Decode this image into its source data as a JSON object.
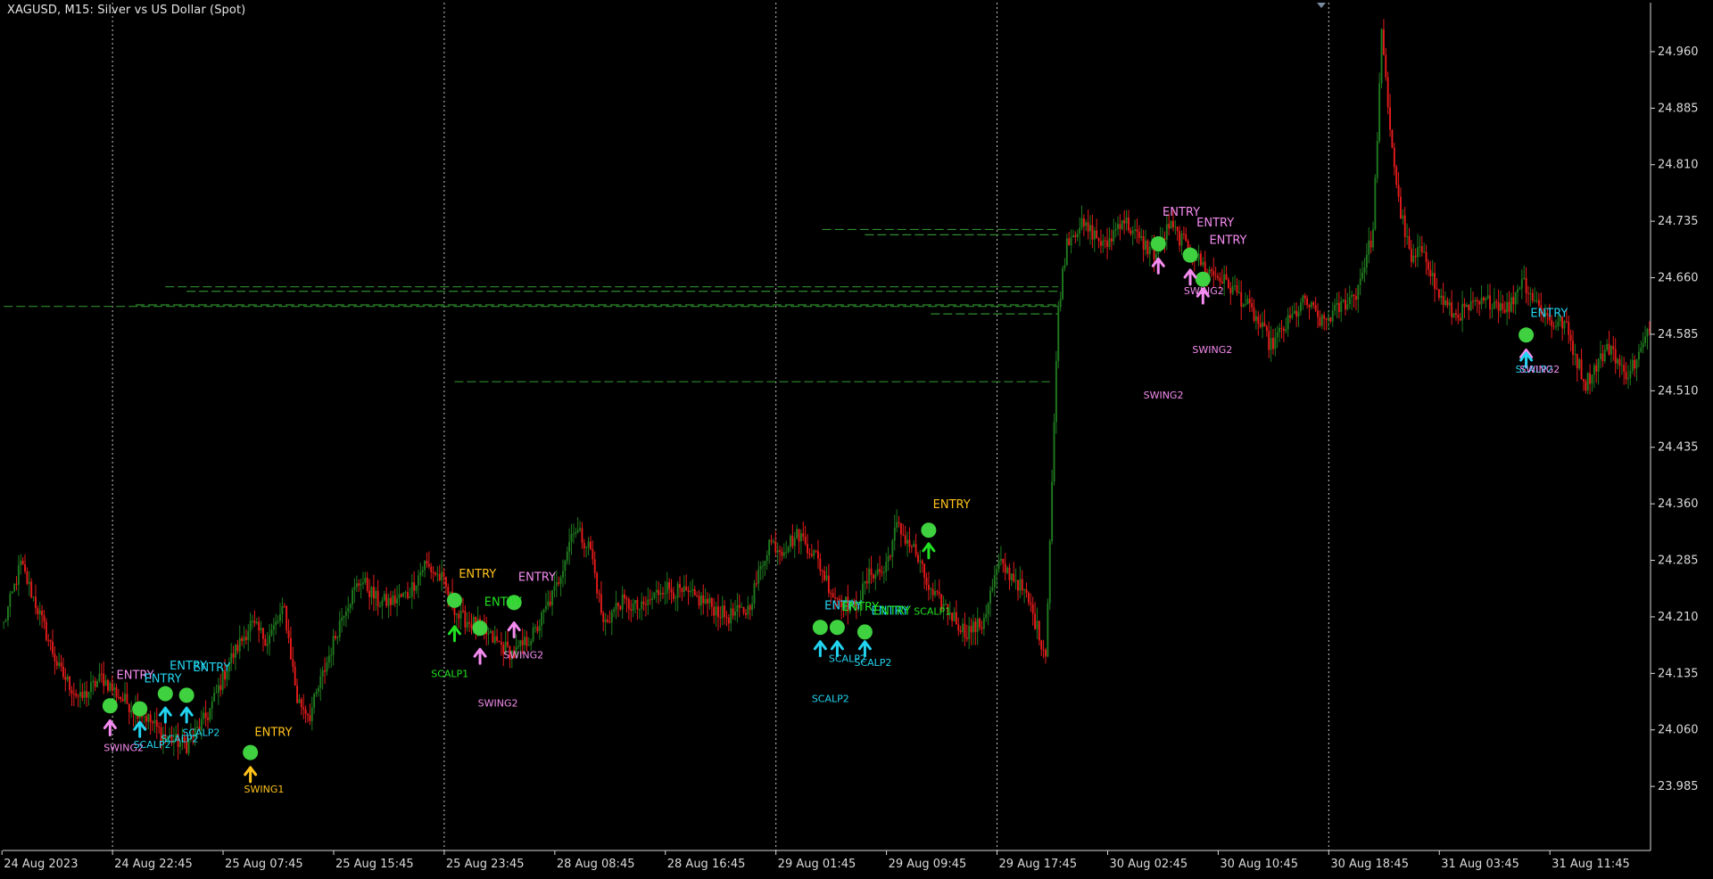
{
  "window": {
    "symbol_title": "XAGUSD, M15:  Silver vs US Dollar (Spot)"
  },
  "colors": {
    "background": "#000000",
    "axis": "#d9d9d9",
    "grid": "#c8c8c8",
    "bull": "#1f7a1f",
    "bear": "#e61b1b",
    "level_line": "#2e8b2e",
    "dot": "#3fd13f",
    "swing1": "#ffc21a",
    "swing2": "#f58cf0",
    "scalp1": "#22e022",
    "scalp2": "#22d4f0"
  },
  "chart_data": {
    "type": "candlestick",
    "title": "XAGUSD, M15:  Silver vs US Dollar (Spot)",
    "ylim": [
      23.9,
      25.025
    ],
    "y_ticks": [
      "24.960",
      "24.885",
      "24.810",
      "24.735",
      "24.660",
      "24.585",
      "24.510",
      "24.435",
      "24.360",
      "24.285",
      "24.210",
      "24.135",
      "24.060",
      "23.985"
    ],
    "x_ticks": [
      "24 Aug 2023",
      "24 Aug 22:45",
      "25 Aug 07:45",
      "25 Aug 15:45",
      "25 Aug 23:45",
      "28 Aug 08:45",
      "28 Aug 16:45",
      "29 Aug 01:45",
      "29 Aug 09:45",
      "29 Aug 17:45",
      "30 Aug 02:45",
      "30 Aug 10:45",
      "30 Aug 18:45",
      "31 Aug 03:45",
      "31 Aug 11:45"
    ],
    "session_separators": [
      "24 Aug 22:45",
      "25 Aug 23:45",
      "29 Aug 01:45",
      "29 Aug 17:45",
      "30 Aug 18:45"
    ],
    "price_path": [
      [
        0,
        24.2
      ],
      [
        8,
        24.28
      ],
      [
        16,
        24.22
      ],
      [
        26,
        24.14
      ],
      [
        36,
        24.1
      ],
      [
        46,
        24.13
      ],
      [
        56,
        24.1
      ],
      [
        66,
        24.08
      ],
      [
        76,
        24.05
      ],
      [
        86,
        24.04
      ],
      [
        96,
        24.08
      ],
      [
        106,
        24.15
      ],
      [
        116,
        24.2
      ],
      [
        124,
        24.18
      ],
      [
        132,
        24.22
      ],
      [
        138,
        24.1
      ],
      [
        144,
        24.08
      ],
      [
        152,
        24.15
      ],
      [
        160,
        24.22
      ],
      [
        168,
        24.26
      ],
      [
        176,
        24.23
      ],
      [
        182,
        24.23
      ],
      [
        190,
        24.24
      ],
      [
        198,
        24.28
      ],
      [
        206,
        24.26
      ],
      [
        214,
        24.21
      ],
      [
        222,
        24.2
      ],
      [
        230,
        24.18
      ],
      [
        240,
        24.16
      ],
      [
        250,
        24.19
      ],
      [
        260,
        24.25
      ],
      [
        268,
        24.33
      ],
      [
        276,
        24.3
      ],
      [
        282,
        24.2
      ],
      [
        290,
        24.23
      ],
      [
        300,
        24.22
      ],
      [
        310,
        24.25
      ],
      [
        320,
        24.24
      ],
      [
        330,
        24.23
      ],
      [
        340,
        24.21
      ],
      [
        350,
        24.22
      ],
      [
        360,
        24.31
      ],
      [
        366,
        24.3
      ],
      [
        374,
        24.32
      ],
      [
        382,
        24.29
      ],
      [
        390,
        24.24
      ],
      [
        400,
        24.22
      ],
      [
        408,
        24.27
      ],
      [
        414,
        24.27
      ],
      [
        420,
        24.33
      ],
      [
        428,
        24.3
      ],
      [
        436,
        24.24
      ],
      [
        444,
        24.22
      ],
      [
        452,
        24.19
      ],
      [
        460,
        24.2
      ],
      [
        468,
        24.28
      ],
      [
        476,
        24.26
      ],
      [
        482,
        24.23
      ],
      [
        490,
        24.16
      ],
      [
        496,
        24.62
      ],
      [
        500,
        24.71
      ],
      [
        506,
        24.73
      ],
      [
        512,
        24.72
      ],
      [
        518,
        24.7
      ],
      [
        526,
        24.74
      ],
      [
        534,
        24.71
      ],
      [
        542,
        24.69
      ],
      [
        548,
        24.73
      ],
      [
        554,
        24.71
      ],
      [
        560,
        24.69
      ],
      [
        566,
        24.67
      ],
      [
        572,
        24.66
      ],
      [
        580,
        24.64
      ],
      [
        588,
        24.61
      ],
      [
        596,
        24.57
      ],
      [
        604,
        24.6
      ],
      [
        612,
        24.63
      ],
      [
        620,
        24.6
      ],
      [
        628,
        24.62
      ],
      [
        636,
        24.64
      ],
      [
        644,
        24.72
      ],
      [
        648,
        24.98
      ],
      [
        652,
        24.86
      ],
      [
        656,
        24.76
      ],
      [
        662,
        24.68
      ],
      [
        668,
        24.7
      ],
      [
        674,
        24.64
      ],
      [
        682,
        24.61
      ],
      [
        690,
        24.62
      ],
      [
        700,
        24.63
      ],
      [
        708,
        24.62
      ],
      [
        714,
        24.66
      ],
      [
        720,
        24.63
      ],
      [
        728,
        24.6
      ],
      [
        734,
        24.6
      ],
      [
        740,
        24.55
      ],
      [
        744,
        24.52
      ],
      [
        750,
        24.55
      ],
      [
        756,
        24.57
      ],
      [
        762,
        24.53
      ],
      [
        768,
        24.55
      ],
      [
        774,
        24.59
      ]
    ],
    "level_lines": [
      {
        "from_bar": 0,
        "to_bar": 496,
        "price": 24.622
      },
      {
        "from_bar": 62,
        "to_bar": 496,
        "price": 24.624
      },
      {
        "from_bar": 76,
        "to_bar": 496,
        "price": 24.648
      },
      {
        "from_bar": 86,
        "to_bar": 496,
        "price": 24.642
      },
      {
        "from_bar": 436,
        "to_bar": 496,
        "price": 24.612
      },
      {
        "from_bar": 212,
        "to_bar": 492,
        "price": 24.522
      },
      {
        "from_bar": 385,
        "to_bar": 496,
        "price": 24.724
      },
      {
        "from_bar": 405,
        "to_bar": 496,
        "price": 24.717
      }
    ],
    "entry_dots": [
      {
        "bar": 50,
        "price": 24.092
      },
      {
        "bar": 64,
        "price": 24.088
      },
      {
        "bar": 76,
        "price": 24.108
      },
      {
        "bar": 86,
        "price": 24.106
      },
      {
        "bar": 116,
        "price": 24.03
      },
      {
        "bar": 212,
        "price": 24.232
      },
      {
        "bar": 224,
        "price": 24.195
      },
      {
        "bar": 240,
        "price": 24.229
      },
      {
        "bar": 384,
        "price": 24.196
      },
      {
        "bar": 392,
        "price": 24.196
      },
      {
        "bar": 405,
        "price": 24.19
      },
      {
        "bar": 435,
        "price": 24.325
      },
      {
        "bar": 543,
        "price": 24.705
      },
      {
        "bar": 558,
        "price": 24.69
      },
      {
        "bar": 564,
        "price": 24.658
      },
      {
        "bar": 716,
        "price": 24.584
      }
    ],
    "arrows": [
      {
        "bar": 50,
        "price": 24.065,
        "type": "swing2"
      },
      {
        "bar": 64,
        "price": 24.063,
        "type": "scalp2"
      },
      {
        "bar": 76,
        "price": 24.082,
        "type": "scalp2"
      },
      {
        "bar": 86,
        "price": 24.082,
        "type": "scalp2"
      },
      {
        "bar": 116,
        "price": 24.003,
        "type": "swing1"
      },
      {
        "bar": 212,
        "price": 24.19,
        "type": "scalp1"
      },
      {
        "bar": 224,
        "price": 24.16,
        "type": "swing2"
      },
      {
        "bar": 240,
        "price": 24.195,
        "type": "swing2"
      },
      {
        "bar": 384,
        "price": 24.17,
        "type": "scalp2"
      },
      {
        "bar": 392,
        "price": 24.17,
        "type": "scalp2"
      },
      {
        "bar": 405,
        "price": 24.17,
        "type": "scalp2"
      },
      {
        "bar": 435,
        "price": 24.3,
        "type": "scalp1"
      },
      {
        "bar": 543,
        "price": 24.678,
        "type": "swing2"
      },
      {
        "bar": 558,
        "price": 24.663,
        "type": "swing2"
      },
      {
        "bar": 564,
        "price": 24.638,
        "type": "swing2"
      },
      {
        "bar": 716,
        "price": 24.557,
        "type": "swing2"
      },
      {
        "bar": 716,
        "price": 24.553,
        "type": "scalp2"
      }
    ],
    "labels": [
      {
        "bar": 53,
        "price": 24.128,
        "text": "ENTRY",
        "type": "swing2"
      },
      {
        "bar": 66,
        "price": 24.123,
        "text": "ENTRY",
        "type": "scalp2"
      },
      {
        "bar": 78,
        "price": 24.14,
        "text": "ENTRY",
        "type": "scalp2"
      },
      {
        "bar": 89,
        "price": 24.138,
        "text": "ENTRY",
        "type": "scalp2"
      },
      {
        "bar": 118,
        "price": 24.052,
        "text": "ENTRY",
        "type": "swing1"
      },
      {
        "bar": 214,
        "price": 24.262,
        "text": "ENTRY",
        "type": "swing1"
      },
      {
        "bar": 226,
        "price": 24.225,
        "text": "ENTRY",
        "type": "scalp1"
      },
      {
        "bar": 242,
        "price": 24.258,
        "text": "ENTRY",
        "type": "swing2"
      },
      {
        "bar": 386,
        "price": 24.22,
        "text": "ENTRY",
        "type": "scalp2"
      },
      {
        "bar": 394,
        "price": 24.218,
        "text": "ENTRY",
        "type": "scalp1"
      },
      {
        "bar": 408,
        "price": 24.213,
        "text": "ENTRY",
        "type": "scalp2"
      },
      {
        "bar": 437,
        "price": 24.354,
        "text": "ENTRY",
        "type": "swing1"
      },
      {
        "bar": 545,
        "price": 24.742,
        "text": "ENTRY",
        "type": "swing2"
      },
      {
        "bar": 561,
        "price": 24.728,
        "text": "ENTRY",
        "type": "swing2"
      },
      {
        "bar": 567,
        "price": 24.705,
        "text": "ENTRY",
        "type": "swing2"
      },
      {
        "bar": 718,
        "price": 24.608,
        "text": "ENTRY",
        "type": "scalp2"
      },
      {
        "bar": 47,
        "price": 24.032,
        "text": "SWING2",
        "type": "swing2"
      },
      {
        "bar": 61,
        "price": 24.036,
        "text": "SCALP2",
        "type": "scalp2"
      },
      {
        "bar": 74,
        "price": 24.044,
        "text": "SCALP2",
        "type": "scalp2"
      },
      {
        "bar": 84,
        "price": 24.052,
        "text": "SCALP2",
        "type": "scalp2"
      },
      {
        "bar": 113,
        "price": 23.977,
        "text": "SWING1",
        "type": "swing1"
      },
      {
        "bar": 201,
        "price": 24.13,
        "text": "SCALP1",
        "type": "scalp1"
      },
      {
        "bar": 223,
        "price": 24.091,
        "text": "SWING2",
        "type": "swing2"
      },
      {
        "bar": 235,
        "price": 24.155,
        "text": "SWING2",
        "type": "swing2"
      },
      {
        "bar": 380,
        "price": 24.097,
        "text": "SCALP2",
        "type": "scalp2"
      },
      {
        "bar": 388,
        "price": 24.15,
        "text": "SCALP2",
        "type": "scalp2"
      },
      {
        "bar": 400,
        "price": 24.145,
        "text": "SCALP2",
        "type": "scalp2"
      },
      {
        "bar": 409,
        "price": 24.213,
        "text": "ENTRY",
        "type": "scalp1"
      },
      {
        "bar": 428,
        "price": 24.213,
        "text": "SCALP1",
        "type": "scalp1"
      },
      {
        "bar": 536,
        "price": 24.5,
        "text": "SWING2",
        "type": "swing2"
      },
      {
        "bar": 555,
        "price": 24.638,
        "text": "SWING2",
        "type": "swing2"
      },
      {
        "bar": 559,
        "price": 24.56,
        "text": "SWING2",
        "type": "swing2"
      },
      {
        "bar": 711,
        "price": 24.534,
        "text": "SCALP2",
        "type": "scalp2"
      },
      {
        "bar": 713,
        "price": 24.534,
        "text": "SWING2",
        "type": "swing2"
      }
    ],
    "grid": false,
    "legend": "none"
  }
}
